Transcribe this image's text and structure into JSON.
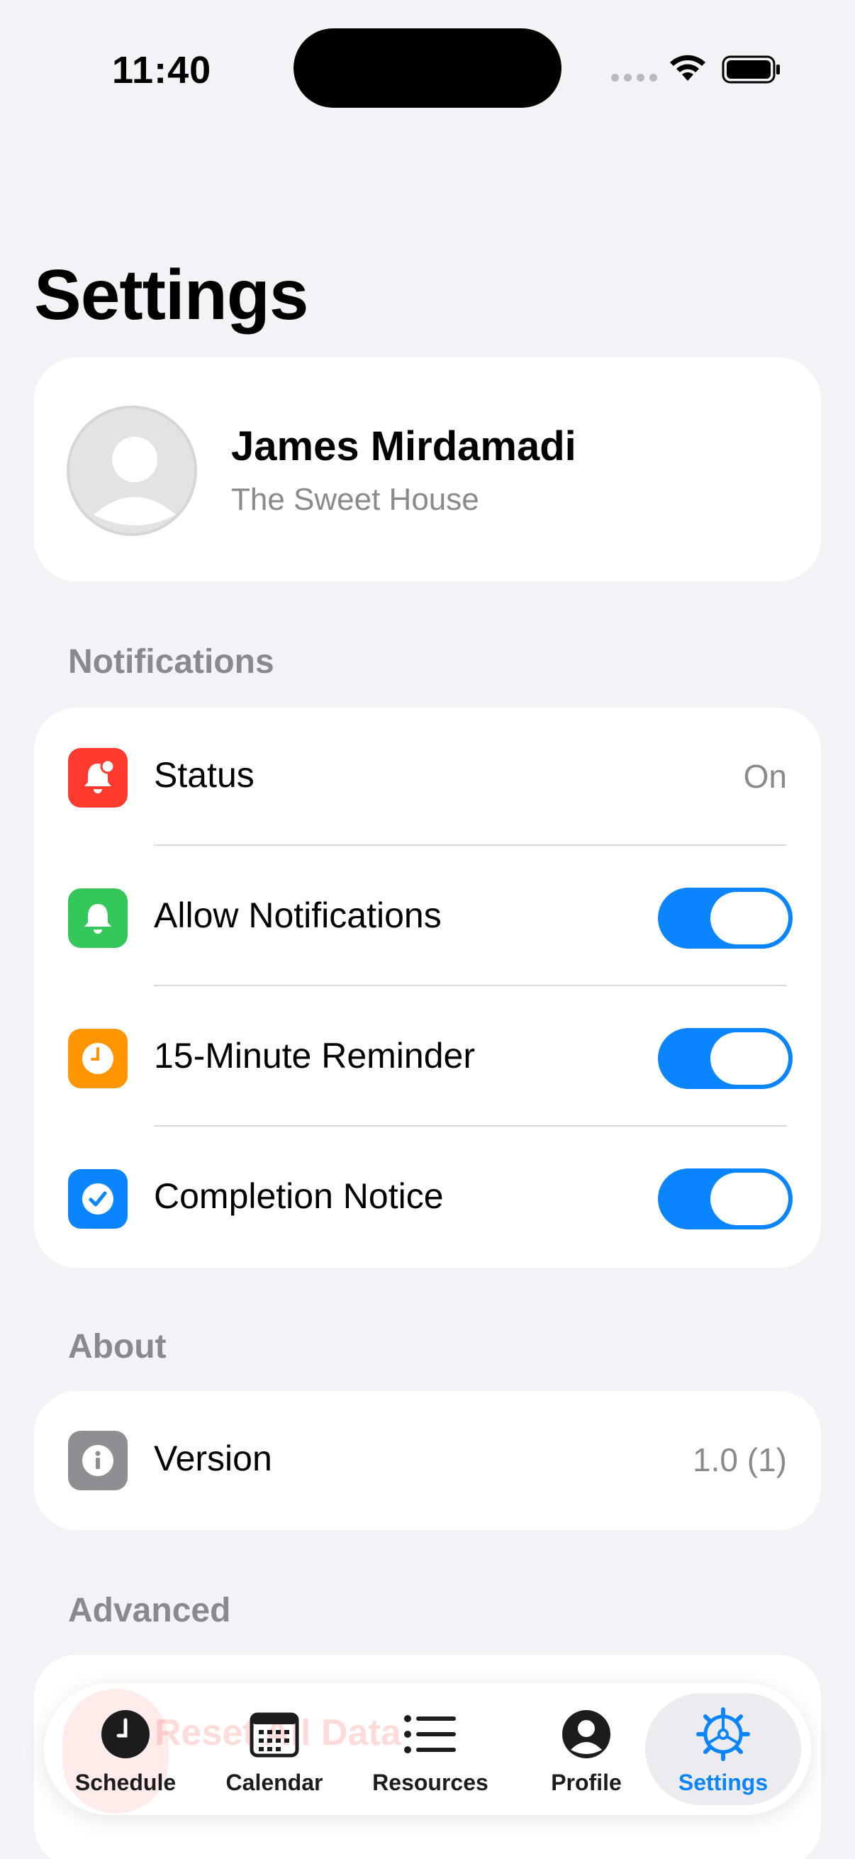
{
  "status_bar": {
    "time": "11:40"
  },
  "page": {
    "title": "Settings"
  },
  "profile": {
    "name": "James Mirdamadi",
    "subtitle": "The Sweet House"
  },
  "sections": {
    "notifications": {
      "header": "Notifications",
      "rows": [
        {
          "label": "Status",
          "value": "On",
          "icon": "bell-badge-icon",
          "color": "#ff3b30"
        },
        {
          "label": "Allow Notifications",
          "toggle": true,
          "icon": "bell-icon",
          "color": "#34c759"
        },
        {
          "label": "15-Minute Reminder",
          "toggle": true,
          "icon": "clock-icon",
          "color": "#ff9500"
        },
        {
          "label": "Completion Notice",
          "toggle": true,
          "icon": "checkmark-circle-icon",
          "color": "#0a84ff"
        }
      ]
    },
    "about": {
      "header": "About",
      "rows": [
        {
          "label": "Version",
          "value": "1.0 (1)",
          "icon": "info-icon",
          "color": "#8e8e93"
        }
      ]
    },
    "advanced": {
      "header": "Advanced",
      "rows": [
        {
          "label": "Reset All Data",
          "icon": "reset-icon",
          "color": "#ff3b30"
        }
      ]
    }
  },
  "tab_bar": {
    "tabs": [
      {
        "label": "Schedule",
        "icon": "clock-icon"
      },
      {
        "label": "Calendar",
        "icon": "calendar-icon"
      },
      {
        "label": "Resources",
        "icon": "list-icon"
      },
      {
        "label": "Profile",
        "icon": "person-circle-icon"
      },
      {
        "label": "Settings",
        "icon": "gear-icon",
        "active": true
      }
    ]
  },
  "colors": {
    "accent": "#0a84ff",
    "background": "#f2f2f7"
  }
}
